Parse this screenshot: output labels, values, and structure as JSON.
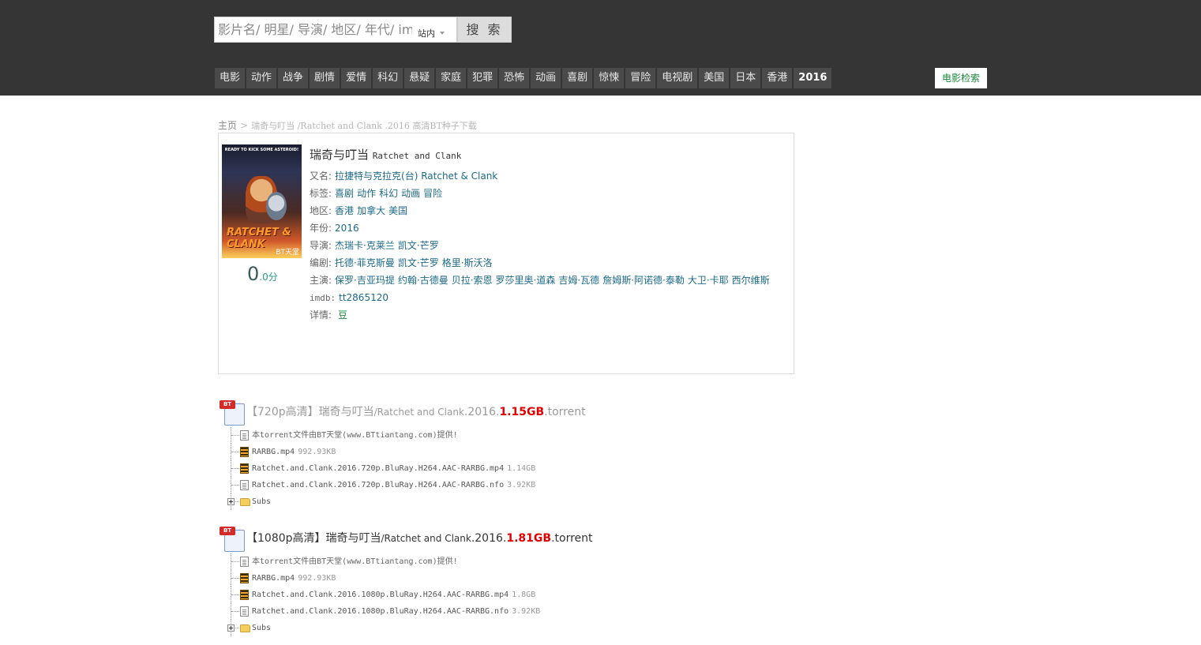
{
  "search": {
    "placeholder": "影片名/ 明星/ 导演/ 地区/ 年代/ imdb",
    "scope": "站内",
    "button": "搜 索"
  },
  "nav": {
    "items": [
      "电影",
      "动作",
      "战争",
      "剧情",
      "爱情",
      "科幻",
      "悬疑",
      "家庭",
      "犯罪",
      "恐怖",
      "动画",
      "喜剧",
      "惊悚",
      "冒险",
      "电视剧",
      "美国",
      "日本",
      "香港",
      "2016"
    ],
    "search_link": "电影检索"
  },
  "breadcrumb": {
    "home": "主页",
    "sep": ">",
    "current": "瑞奇与叮当 /Ratchet and Clank .2016 高清BT种子下载"
  },
  "movie": {
    "title_cn": "瑞奇与叮当",
    "title_en": "Ratchet and Clank",
    "poster": {
      "top_text": "READY TO KICK SOME ASTEROID!",
      "logo": "RATCHET & CLANK",
      "watermark": "BT天堂"
    },
    "rating_int": "0",
    "rating_dec": ".0分",
    "rows": {
      "alias": {
        "label": "又名:",
        "values": [
          "拉捷特与克拉克(台) Ratchet & Clank"
        ]
      },
      "tags": {
        "label": "标签:",
        "values": [
          "喜剧",
          "动作",
          "科幻",
          "动画",
          "冒险"
        ]
      },
      "region": {
        "label": "地区:",
        "values": [
          "香港",
          "加拿大",
          "美国"
        ]
      },
      "year": {
        "label": "年份:",
        "values": [
          "2016"
        ]
      },
      "director": {
        "label": "导演:",
        "values": [
          "杰瑞卡·克莱兰",
          "凯文·芒罗"
        ]
      },
      "writer": {
        "label": "编剧:",
        "values": [
          "托德·菲克斯曼",
          "凯文·芒罗",
          "格里·斯沃洛"
        ]
      },
      "cast": {
        "label": "主演:",
        "values": [
          "保罗·吉亚玛提",
          "约翰·古德曼",
          "贝拉·索恩",
          "罗莎里奥·道森",
          "吉姆·瓦德",
          "詹姆斯·阿诺德·泰勒",
          "大卫·卡耶",
          "西尔维斯"
        ]
      },
      "imdb": {
        "label": "imdb:",
        "values": [
          "tt2865120"
        ]
      },
      "detail": {
        "label": "详情:",
        "douban": "豆"
      }
    }
  },
  "torrents": [
    {
      "quality": "【720p高清】瑞奇与叮当",
      "filename": "/Ratchet and Clank",
      "year": ".2016.",
      "size": "1.15GB",
      "ext": ".torrent",
      "files": [
        {
          "icon": "doc",
          "name": "本torrent文件由BT天堂(www.BTtiantang.com)提供!",
          "size": ""
        },
        {
          "icon": "film",
          "name": "RARBG.mp4",
          "size": "992.93KB"
        },
        {
          "icon": "film",
          "name": "Ratchet.and.Clank.2016.720p.BluRay.H264.AAC-RARBG.mp4",
          "size": "1.14GB"
        },
        {
          "icon": "doc",
          "name": "Ratchet.and.Clank.2016.720p.BluRay.H264.AAC-RARBG.nfo",
          "size": "3.92KB"
        },
        {
          "icon": "folder",
          "name": "Subs",
          "size": ""
        }
      ]
    },
    {
      "quality": "【1080p高清】瑞奇与叮当",
      "filename": "/Ratchet and Clank",
      "year": ".2016.",
      "size": "1.81GB",
      "ext": ".torrent",
      "files": [
        {
          "icon": "doc",
          "name": "本torrent文件由BT天堂(www.BTtiantang.com)提供!",
          "size": ""
        },
        {
          "icon": "film",
          "name": "RARBG.mp4",
          "size": "992.93KB"
        },
        {
          "icon": "film",
          "name": "Ratchet.and.Clank.2016.1080p.BluRay.H264.AAC-RARBG.mp4",
          "size": "1.8GB"
        },
        {
          "icon": "doc",
          "name": "Ratchet.and.Clank.2016.1080p.BluRay.H264.AAC-RARBG.nfo",
          "size": "3.92KB"
        },
        {
          "icon": "folder",
          "name": "Subs",
          "size": ""
        }
      ]
    }
  ]
}
